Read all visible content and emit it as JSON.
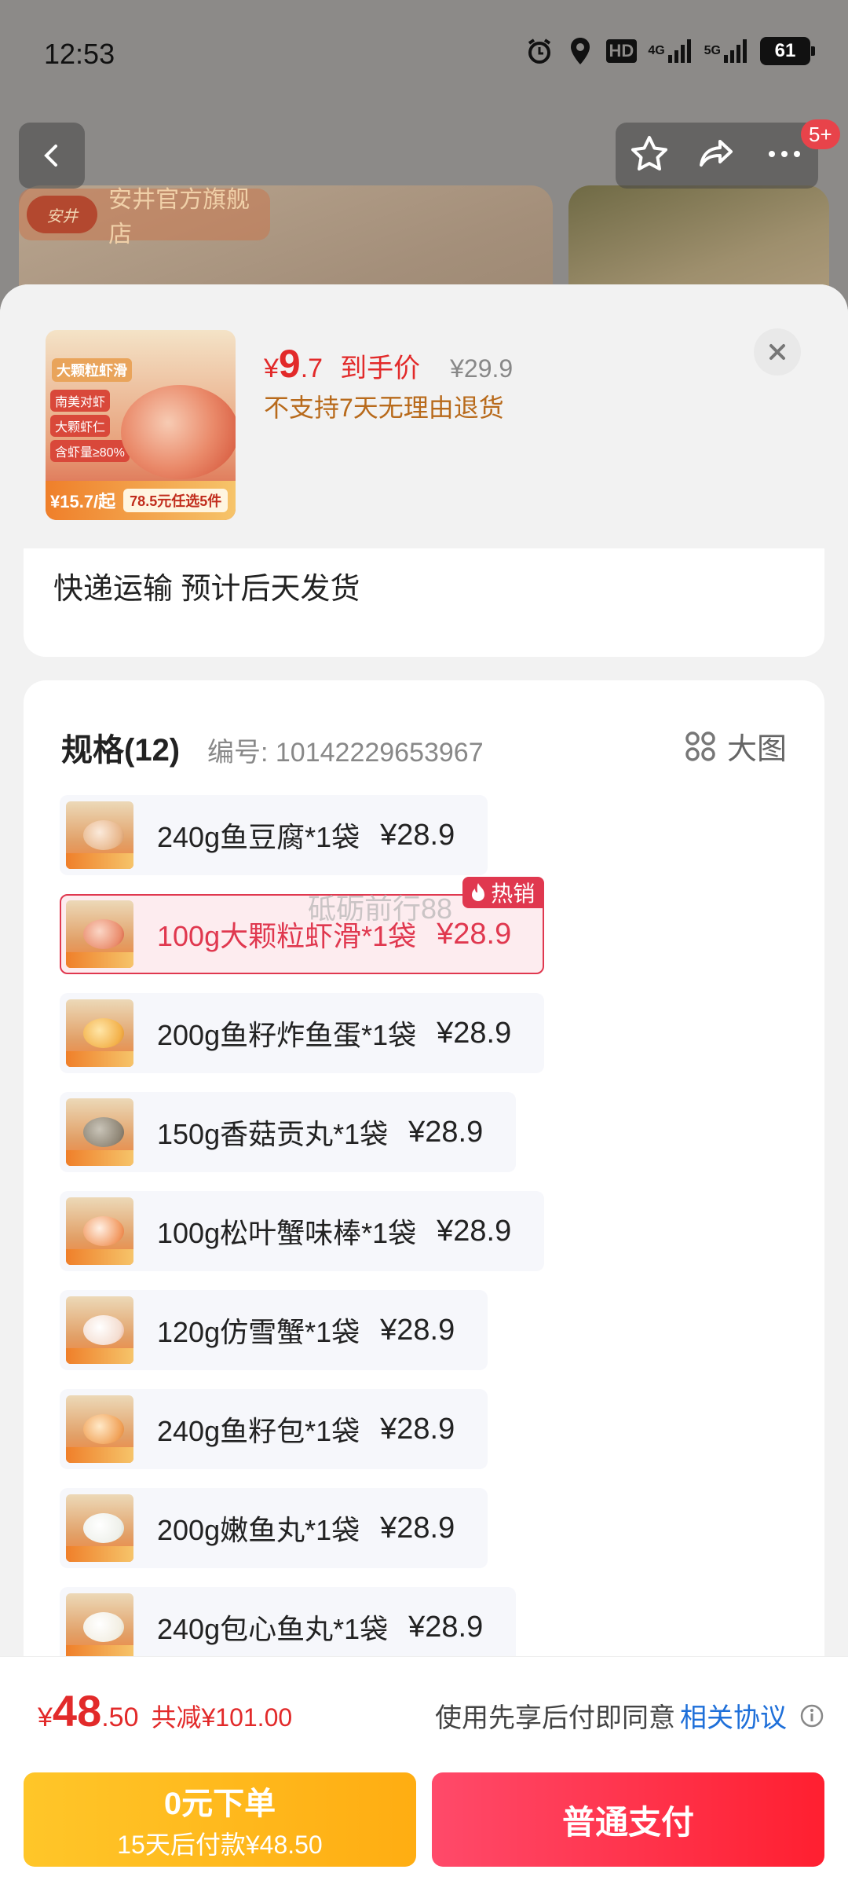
{
  "status_bar": {
    "time": "12:53",
    "hd_label": "HD",
    "net_1": "4G",
    "net_2": "5G",
    "battery": "61"
  },
  "background_page": {
    "store_logo_text": "安井",
    "store_name": "安井官方旗舰店",
    "badge": "5+"
  },
  "product": {
    "price_currency": "¥",
    "price_int": "9",
    "price_dec": ".7",
    "price_label": "到手价",
    "original_price": "¥29.9",
    "return_policy": "不支持7天无理由退货",
    "thumb_title": "大颗粒虾滑",
    "thumb_tags": [
      "南美对虾",
      "大颗虾仁",
      "含虾量≥80%"
    ],
    "thumb_price": "¥15.7/起",
    "thumb_promo": "78.5元任选5件"
  },
  "shipping": {
    "text": "快递运输 预计后天发货"
  },
  "specs": {
    "title": "规格(12)",
    "code": "编号: 10142229653967",
    "big_view_label": "大图",
    "hot_label": "热销",
    "items": [
      {
        "label": "240g鱼豆腐*1袋",
        "price": "¥28.9"
      },
      {
        "label": "100g大颗粒虾滑*1袋",
        "price": "¥28.9"
      },
      {
        "label": "200g鱼籽炸鱼蛋*1袋",
        "price": "¥28.9"
      },
      {
        "label": "150g香菇贡丸*1袋",
        "price": "¥28.9"
      },
      {
        "label": "100g松叶蟹味棒*1袋",
        "price": "¥28.9"
      },
      {
        "label": "120g仿雪蟹*1袋",
        "price": "¥28.9"
      },
      {
        "label": "240g鱼籽包*1袋",
        "price": "¥28.9"
      },
      {
        "label": "200g嫩鱼丸*1袋",
        "price": "¥28.9"
      },
      {
        "label": "240g包心鱼丸*1袋",
        "price": "¥28.9"
      }
    ],
    "watermark": "砥砺前行88"
  },
  "summary": {
    "currency": "¥",
    "total_int": "48",
    "total_dec": ".50",
    "discount": "共减¥101.00",
    "agree_text": "使用先享后付即同意",
    "agree_link": "相关协议"
  },
  "actions": {
    "later_title": "0元下单",
    "later_sub": "15天后付款¥48.50",
    "pay_label": "普通支付"
  },
  "colors": {
    "accent_red": "#e22a2a",
    "selected_border": "#e0384f",
    "pay_later": "#ffb81c",
    "pay_now": "#ff2a3f",
    "link_blue": "#1e6fd9"
  }
}
